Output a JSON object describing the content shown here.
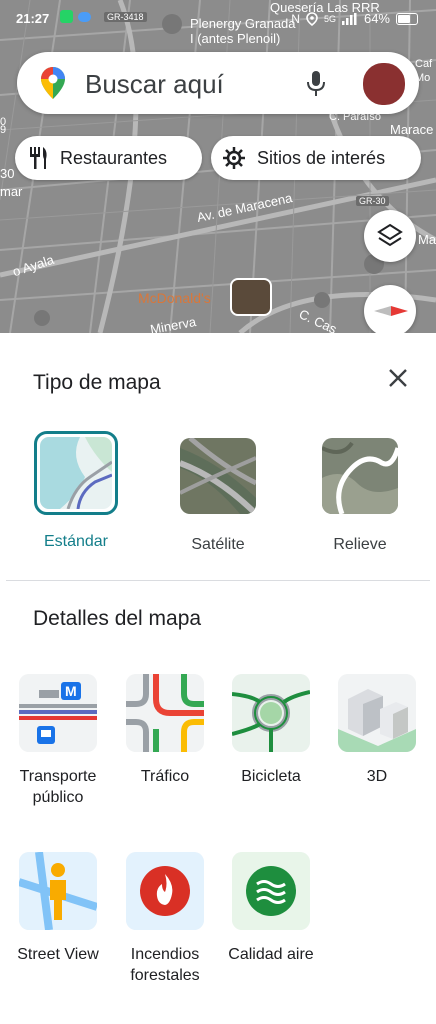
{
  "status_bar": {
    "time": "21:27",
    "battery": "64%",
    "network": "5G"
  },
  "map": {
    "labels": {
      "gr3413": "GR-3418",
      "plenergy": "Plenergy Granada",
      "plenergy2": "I (antes Plenoil)",
      "queseria": "Quesería Las RRR",
      "cparaiso": "C. Paraíso",
      "marace": "Marace",
      "marace2": "Marace",
      "avmaracena": "Av. de Maracena",
      "gr30": "GR-30",
      "ayala": "o Ayala",
      "mcdonalds": "McDonald's",
      "minerva": "Minerva",
      "ccas": "C. Cas",
      "mar": "mar",
      "caf": "Caf",
      "mo": "Mo",
      "n30": "30",
      "n9": "9",
      "n0": "0"
    }
  },
  "search": {
    "placeholder": "Buscar aquí"
  },
  "chips": [
    {
      "label": "Restaurantes"
    },
    {
      "label": "Sitios de interés"
    }
  ],
  "sheet": {
    "map_type_title": "Tipo de mapa",
    "map_types": [
      {
        "label": "Estándar",
        "selected": true
      },
      {
        "label": "Satélite",
        "selected": false
      },
      {
        "label": "Relieve",
        "selected": false
      }
    ],
    "details_title": "Detalles del mapa",
    "details": [
      {
        "line1": "Transporte",
        "line2": "público"
      },
      {
        "line1": "Tráfico",
        "line2": ""
      },
      {
        "line1": "Bicicleta",
        "line2": ""
      },
      {
        "line1": "3D",
        "line2": ""
      },
      {
        "line1": "Street View",
        "line2": ""
      },
      {
        "line1": "Incendios",
        "line2": "forestales"
      },
      {
        "line1": "Calidad aire",
        "line2": ""
      }
    ]
  },
  "colors": {
    "accent": "#137e8a",
    "map_bg": "#8a8a8a"
  }
}
